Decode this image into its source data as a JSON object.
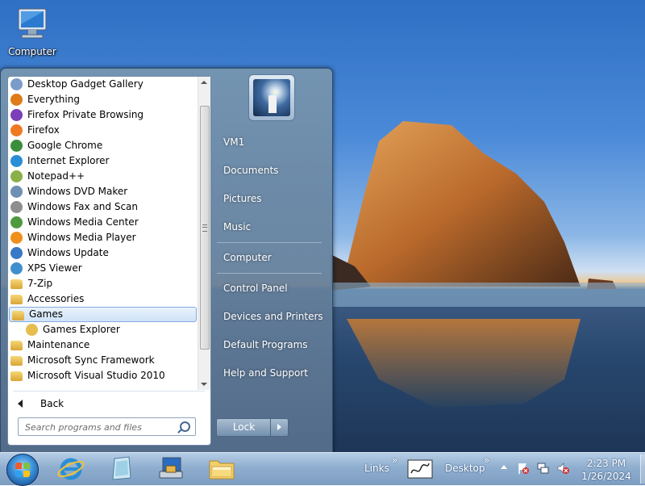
{
  "desktop": {
    "icons": [
      {
        "label": "Computer",
        "icon": "computer-icon"
      }
    ]
  },
  "start_menu": {
    "programs": [
      {
        "label": "Desktop Gadget Gallery",
        "icon": "gadget-icon",
        "color": "#7b9cc9"
      },
      {
        "label": "Everything",
        "icon": "magnifier-icon",
        "color": "#e07b18"
      },
      {
        "label": "Firefox Private Browsing",
        "icon": "firefox-private-icon",
        "color": "#7b3fb7"
      },
      {
        "label": "Firefox",
        "icon": "firefox-icon",
        "color": "#ef7a22"
      },
      {
        "label": "Google Chrome",
        "icon": "chrome-icon",
        "color": "#3b8e3b"
      },
      {
        "label": "Internet Explorer",
        "icon": "ie-icon",
        "color": "#2a8ed6"
      },
      {
        "label": "Notepad++",
        "icon": "notepadpp-icon",
        "color": "#8ab04a"
      },
      {
        "label": "Windows DVD Maker",
        "icon": "dvd-maker-icon",
        "color": "#6f8fb5"
      },
      {
        "label": "Windows Fax and Scan",
        "icon": "fax-icon",
        "color": "#8e8e8e"
      },
      {
        "label": "Windows Media Center",
        "icon": "media-center-icon",
        "color": "#4f9a3f"
      },
      {
        "label": "Windows Media Player",
        "icon": "media-player-icon",
        "color": "#ef8f1c"
      },
      {
        "label": "Windows Update",
        "icon": "windows-update-icon",
        "color": "#3a79c5"
      },
      {
        "label": "XPS Viewer",
        "icon": "xps-viewer-icon",
        "color": "#3f8fcf"
      },
      {
        "label": "7-Zip",
        "icon": "folder-icon",
        "color": "#e6bd4f"
      },
      {
        "label": "Accessories",
        "icon": "folder-icon",
        "color": "#e6bd4f"
      },
      {
        "label": "Games",
        "icon": "folder-icon",
        "color": "#e6bd4f",
        "selected": true
      },
      {
        "label": "Games Explorer",
        "icon": "games-explorer-icon",
        "color": "#e6bd4f",
        "sub": true
      },
      {
        "label": "Maintenance",
        "icon": "folder-icon",
        "color": "#e6bd4f"
      },
      {
        "label": "Microsoft Sync Framework",
        "icon": "folder-icon",
        "color": "#e6bd4f"
      },
      {
        "label": "Microsoft Visual Studio 2010",
        "icon": "folder-icon",
        "color": "#e6bd4f"
      }
    ],
    "back_label": "Back",
    "search": {
      "placeholder": "Search programs and files"
    },
    "right": {
      "user": "VM1",
      "documents": "Documents",
      "pictures": "Pictures",
      "music": "Music",
      "computer": "Computer",
      "control_panel": "Control Panel",
      "devices": "Devices and Printers",
      "default_programs": "Default Programs",
      "help": "Help and Support"
    },
    "lock_label": "Lock"
  },
  "taskbar": {
    "links_label": "Links",
    "desktop_label": "Desktop",
    "time": "2:23 PM",
    "date": "1/26/2024",
    "chevron": "»"
  }
}
